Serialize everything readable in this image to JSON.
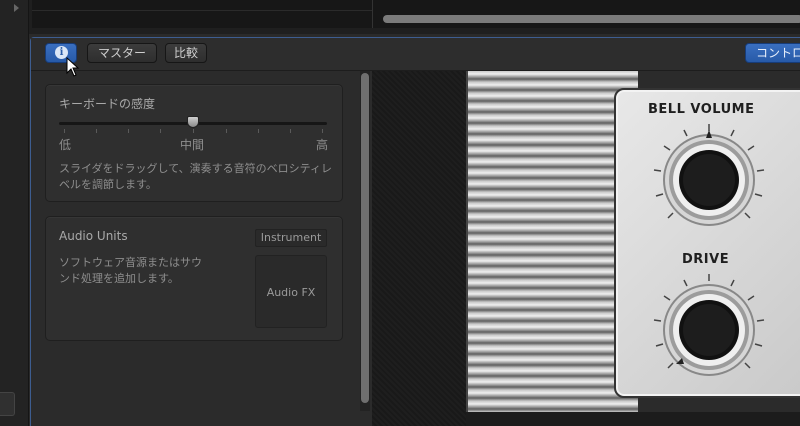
{
  "toolbar": {
    "info_icon": "i",
    "master_label": "マスター",
    "compare_label": "比較",
    "control_label": "コントロ"
  },
  "keyboard_sensitivity": {
    "title": "キーボードの感度",
    "low_label": "低",
    "mid_label": "中間",
    "high_label": "高",
    "value": 0.5,
    "description": "スライダをドラッグして、演奏する音符のベロシティレベルを調節します。"
  },
  "audio_units": {
    "title": "Audio Units",
    "instrument_slot": "Instrument",
    "description": "ソフトウェア音源またはサウンド処理を追加します。",
    "audio_fx_slot": "Audio FX"
  },
  "instrument": {
    "bell_volume_label": "BELL VOLUME",
    "drive_label": "DRIVE"
  },
  "colors": {
    "accent": "#2f63b3",
    "panel_bg": "#2b2b2b"
  }
}
